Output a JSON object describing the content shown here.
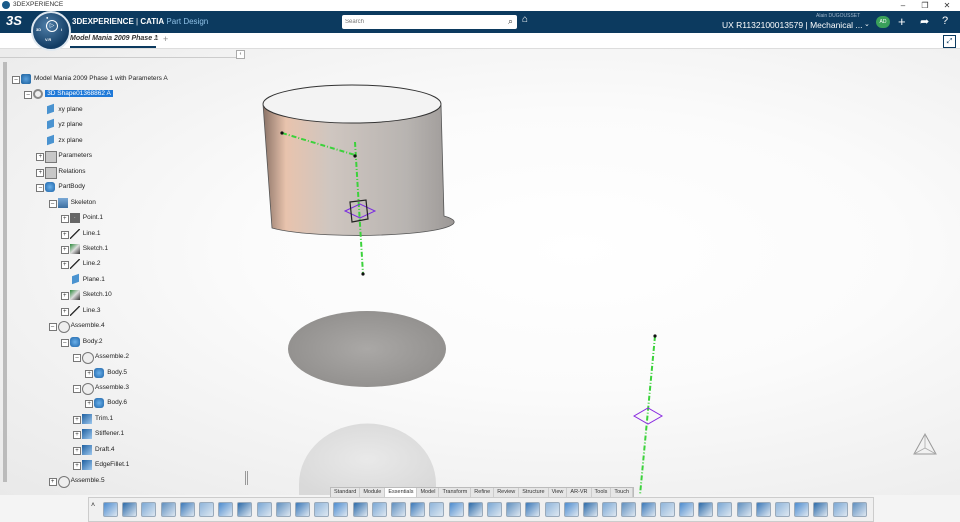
{
  "window": {
    "title": "3DEXPERIENCE",
    "controls": [
      "–",
      "❐",
      "✕"
    ]
  },
  "header": {
    "brand_platform": "3DEXPERIENCE",
    "brand_separator": " | ",
    "brand_product": "CATIA",
    "brand_app": "Part Design",
    "compass_version": "V.R",
    "search_placeholder": "Search",
    "user_name": "Alain DUGOUSSET",
    "context": "UX R1132100013579 | Mechanical ...",
    "avatar_initials": "AD"
  },
  "tabs": {
    "document": "Model Mania 2009 Phase 1",
    "close": "x",
    "add": "+"
  },
  "tree": {
    "nodes": [
      {
        "id": "root",
        "label": "Model Mania 2009 Phase 1 with Parameters A",
        "icon": "product-icon",
        "depth": 0,
        "toggle": "–"
      },
      {
        "id": "shape",
        "label": "3D Shape01368862 A",
        "icon": "shape-icon",
        "depth": 1,
        "toggle": "–",
        "selected": true
      },
      {
        "id": "xy",
        "label": "xy plane",
        "icon": "plane-icon",
        "depth": 2,
        "toggle": ""
      },
      {
        "id": "yz",
        "label": "yz plane",
        "icon": "plane-icon",
        "depth": 2,
        "toggle": ""
      },
      {
        "id": "zx",
        "label": "zx plane",
        "icon": "plane-icon",
        "depth": 2,
        "toggle": ""
      },
      {
        "id": "params",
        "label": "Parameters",
        "icon": "parameters-icon",
        "depth": 2,
        "toggle": "+"
      },
      {
        "id": "relations",
        "label": "Relations",
        "icon": "relations-icon",
        "depth": 2,
        "toggle": "+"
      },
      {
        "id": "partbody",
        "label": "PartBody",
        "icon": "partbody-icon",
        "depth": 2,
        "toggle": "–"
      },
      {
        "id": "skeleton",
        "label": "Skeleton",
        "icon": "skeleton-icon",
        "depth": 3,
        "toggle": "–"
      },
      {
        "id": "point1",
        "label": "Point.1",
        "icon": "point-icon",
        "depth": 4,
        "toggle": "+"
      },
      {
        "id": "line1",
        "label": "Line.1",
        "icon": "line-icon",
        "depth": 4,
        "toggle": "+"
      },
      {
        "id": "sketch1",
        "label": "Sketch.1",
        "icon": "sketch-icon",
        "depth": 4,
        "toggle": "+"
      },
      {
        "id": "line2",
        "label": "Line.2",
        "icon": "line-icon",
        "depth": 4,
        "toggle": "+"
      },
      {
        "id": "plane1",
        "label": "Plane.1",
        "icon": "plane-icon",
        "depth": 4,
        "toggle": ""
      },
      {
        "id": "sketch10",
        "label": "Sketch.10",
        "icon": "sketch-icon",
        "depth": 4,
        "toggle": "+"
      },
      {
        "id": "line3",
        "label": "Line.3",
        "icon": "line-icon",
        "depth": 4,
        "toggle": "+"
      },
      {
        "id": "assemble4",
        "label": "Assemble.4",
        "icon": "assemble-icon",
        "depth": 3,
        "toggle": "–"
      },
      {
        "id": "body2",
        "label": "Body.2",
        "icon": "body-icon",
        "depth": 4,
        "toggle": "–"
      },
      {
        "id": "assemble2",
        "label": "Assemble.2",
        "icon": "assemble-icon",
        "depth": 5,
        "toggle": "–"
      },
      {
        "id": "body5",
        "label": "Body.5",
        "icon": "body-icon",
        "depth": 6,
        "toggle": "+"
      },
      {
        "id": "assemble3",
        "label": "Assemble.3",
        "icon": "assemble-icon",
        "depth": 5,
        "toggle": "–"
      },
      {
        "id": "body6",
        "label": "Body.6",
        "icon": "body-icon",
        "depth": 6,
        "toggle": "+"
      },
      {
        "id": "trim1",
        "label": "Trim.1",
        "icon": "trim-icon",
        "depth": 5,
        "toggle": "+"
      },
      {
        "id": "stiffener1",
        "label": "Stiffener.1",
        "icon": "stiffener-icon",
        "depth": 5,
        "toggle": "+"
      },
      {
        "id": "draft4",
        "label": "Draft.4",
        "icon": "draft-icon",
        "depth": 5,
        "toggle": "+"
      },
      {
        "id": "edgefillet1",
        "label": "EdgeFillet.1",
        "icon": "edgefillet-icon",
        "depth": 5,
        "toggle": "+"
      },
      {
        "id": "assemble5",
        "label": "Assemble.5",
        "icon": "assemble-icon",
        "depth": 3,
        "toggle": "+"
      }
    ]
  },
  "action_bar": {
    "sections": [
      "Standard",
      "Module",
      "Essentials",
      "Model",
      "Transform",
      "Refine",
      "Review",
      "Structure",
      "View",
      "AR-VR",
      "Tools",
      "Touch"
    ],
    "active": "Essentials",
    "tools": [
      "cut-icon",
      "copy-icon",
      "paste-icon",
      "undo-icon",
      "update-icon",
      "sketch-icon",
      "part-icon",
      "point-icon",
      "line-icon",
      "plane-icon",
      "pad-icon",
      "pocket-icon",
      "shaft-icon",
      "groove-icon",
      "rib-icon",
      "slot-icon",
      "hole-icon",
      "fillet-icon",
      "chamfer-icon",
      "draft-icon",
      "shell-icon",
      "thickness-icon",
      "stiffener-icon",
      "mirror-icon",
      "pattern-icon",
      "measure-icon",
      "boolean-icon",
      "assemble-icon",
      "remove-icon",
      "body-icon",
      "trim-icon",
      "split-icon",
      "thickness-surface-icon",
      "close-surface-icon",
      "sew-icon",
      "translate-icon",
      "rotate-icon",
      "scale-icon",
      "affinity-icon",
      "save-icon"
    ]
  }
}
